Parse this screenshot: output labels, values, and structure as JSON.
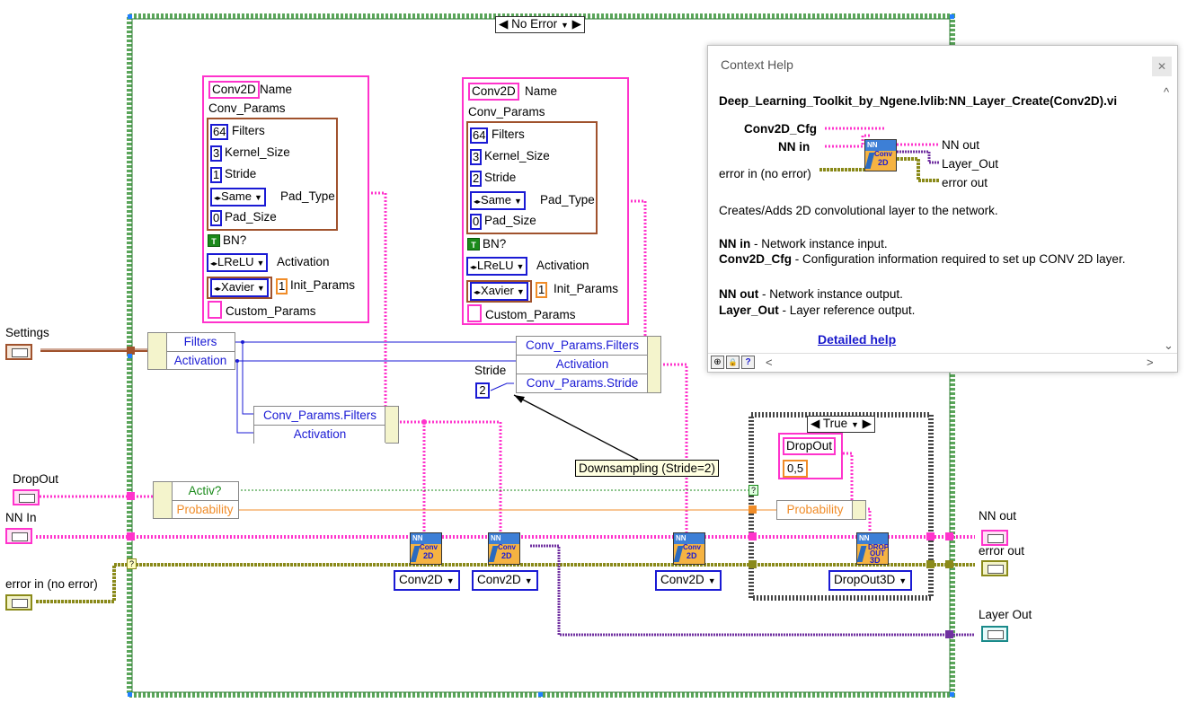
{
  "case_structure": {
    "selector": "No Error"
  },
  "conv_cluster_1": {
    "type_name": "Conv2D",
    "name_label": "Name",
    "params_label": "Conv_Params",
    "filters": "64",
    "filters_label": "Filters",
    "kernel": "3",
    "kernel_label": "Kernel_Size",
    "stride": "1",
    "stride_label": "Stride",
    "pad_type": "Same",
    "pad_type_label": "Pad_Type",
    "pad_size": "0",
    "pad_size_label": "Pad_Size",
    "bn_glyph": "T",
    "bn_label": "BN?",
    "activation": "LReLU",
    "activation_label": "Activation",
    "init": "Xavier",
    "init_value": "1",
    "init_label": "Init_Params",
    "custom_label": "Custom_Params"
  },
  "conv_cluster_2": {
    "type_name": "Conv2D",
    "name_label": "Name",
    "params_label": "Conv_Params",
    "filters": "64",
    "filters_label": "Filters",
    "kernel": "3",
    "kernel_label": "Kernel_Size",
    "stride": "2",
    "stride_label": "Stride",
    "pad_type": "Same",
    "pad_type_label": "Pad_Type",
    "pad_size": "0",
    "pad_size_label": "Pad_Size",
    "bn_glyph": "T",
    "bn_label": "BN?",
    "activation": "LReLU",
    "activation_label": "Activation",
    "init": "Xavier",
    "init_value": "1",
    "init_label": "Init_Params",
    "custom_label": "Custom_Params"
  },
  "settings_unbundle": {
    "rows": [
      "Filters",
      "Activation"
    ]
  },
  "dropout_unbundle": {
    "rows": [
      "Activ?",
      "Probability"
    ]
  },
  "bundle_top": {
    "rows": [
      "Conv_Params.Filters",
      "Activation",
      "Conv_Params.Stride"
    ]
  },
  "bundle_left": {
    "rows": [
      "Conv_Params.Filters",
      "Activation"
    ]
  },
  "stride_const": {
    "label": "Stride",
    "value": "2"
  },
  "annotation": "Downsampling (Stride=2)",
  "inner_case": {
    "selector": "True",
    "dropout_name": "DropOut",
    "dropout_value": "0,5",
    "probability": "Probability"
  },
  "vi_icons": {
    "nn_glyph": "NN",
    "conv_glyph": "Conv",
    "dim_glyph": "2D",
    "drop_glyph": "DROP",
    "out_glyph": "OUT",
    "dim3_glyph": "3D"
  },
  "selectors": [
    "Conv2D",
    "Conv2D",
    "Conv2D",
    "DropOut3D"
  ],
  "terminals": {
    "settings": "Settings",
    "dropout": "DropOut",
    "nn_in": "NN In",
    "error_in": "error in (no error)",
    "nn_out": "NN out",
    "error_out": "error out",
    "layer_out": "Layer Out",
    "question": "?"
  },
  "context_help": {
    "title": "Context Help",
    "close": "✕",
    "vi_name": "Deep_Learning_Toolkit_by_Ngene.lvlib:NN_Layer_Create(Conv2D).vi",
    "conn_cfg": "Conv2D_Cfg",
    "conn_nn_in": "NN in",
    "conn_error_in": "error in (no error)",
    "conn_nn_out": "NN out",
    "conn_layer_out": "Layer_Out",
    "conn_error_out": "error out",
    "description": "Creates/Adds 2D convolutional layer to the network.",
    "params": [
      {
        "name": "NN in",
        "text": " - Network instance input."
      },
      {
        "name": "Conv2D_Cfg",
        "text": " - Configuration information required to set up CONV 2D layer."
      },
      {
        "name": "NN out",
        "text": " - Network instance output."
      },
      {
        "name": "Layer_Out",
        "text": " - Layer reference output."
      }
    ],
    "link": "Detailed help",
    "scroll_up": "^",
    "scroll_down": "⌄",
    "scroll_left": "<",
    "scroll_right": ">",
    "btn_pin": "⊕",
    "btn_lock": "🔒",
    "btn_help": "?"
  },
  "colors": {
    "cluster": "#ff33cc",
    "blue_wire": "#1a1ad4",
    "error_wire": "#8a8a1a",
    "case_border": "#5aa55a"
  }
}
